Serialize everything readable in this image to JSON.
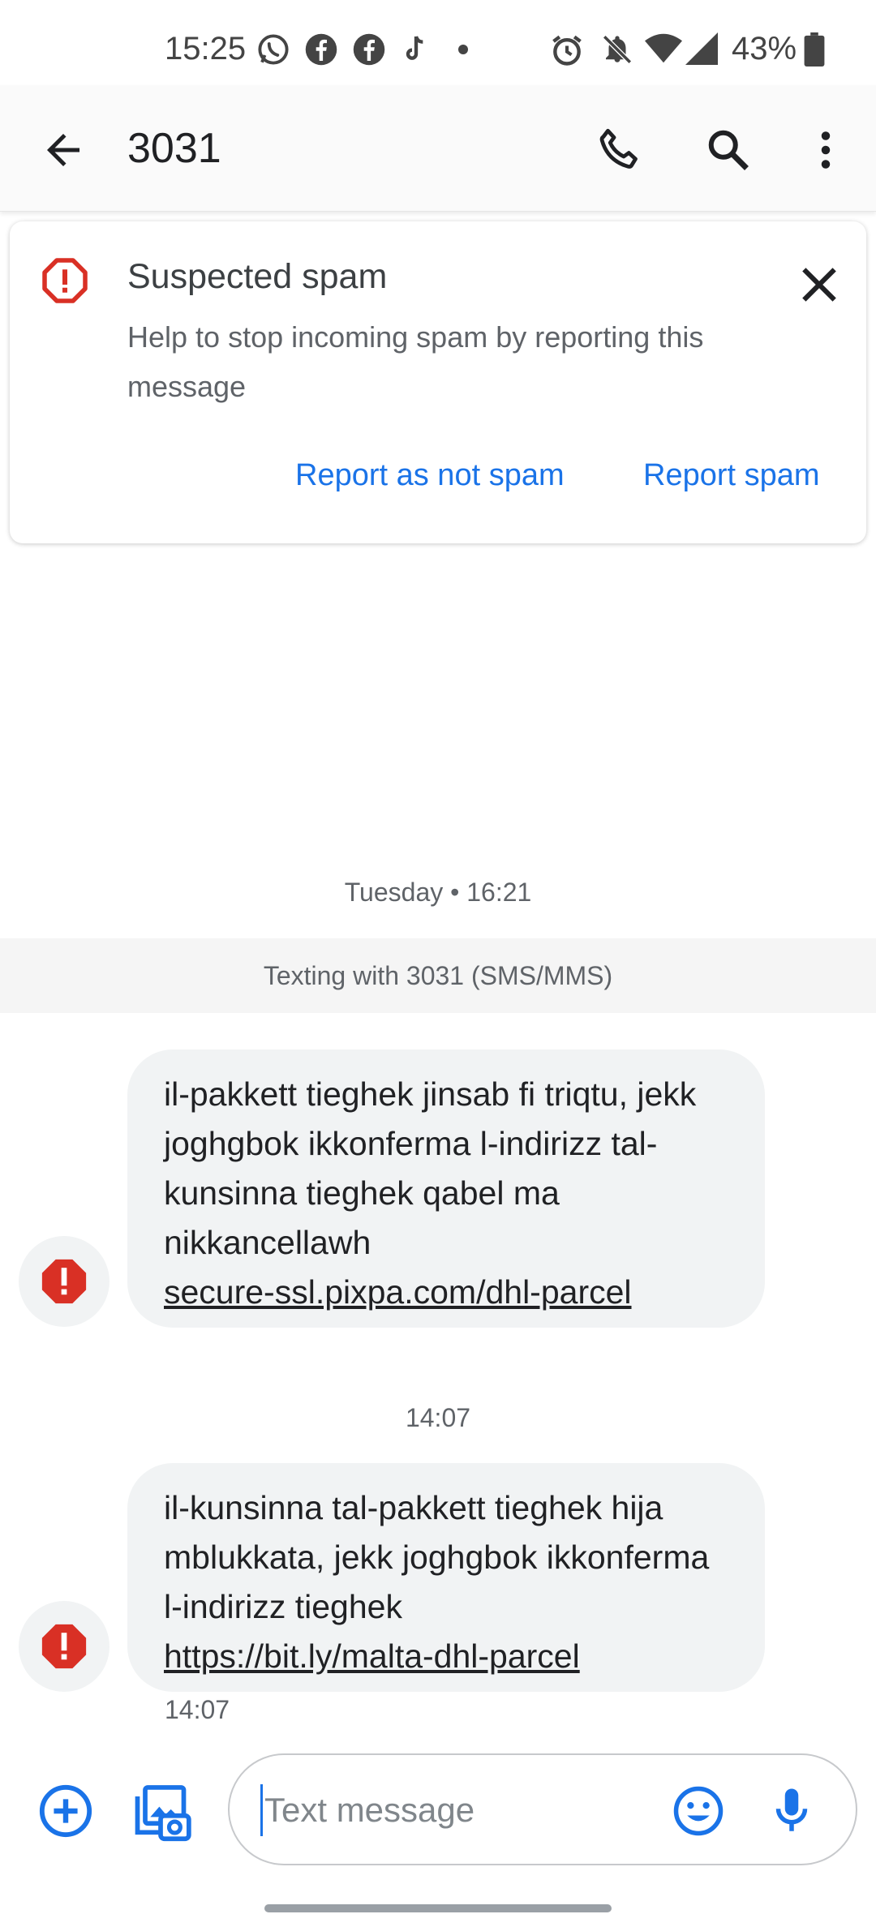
{
  "status_bar": {
    "time": "15:25",
    "notification_icons": [
      "whatsapp-icon",
      "facebook-icon",
      "facebook-icon",
      "tiktok-icon",
      "dot-icon"
    ],
    "system_icons": [
      "alarm-icon",
      "bell-off-icon",
      "wifi-icon",
      "cell-signal-icon",
      "battery-icon"
    ],
    "battery": "43%"
  },
  "app_bar": {
    "title": "3031",
    "icons": [
      "back-arrow-icon",
      "phone-icon",
      "search-icon",
      "more-vert-icon"
    ]
  },
  "spam_banner": {
    "title": "Suspected spam",
    "description": "Help to stop incoming spam by reporting this message",
    "not_spam_label": "Report as not spam",
    "spam_label": "Report spam",
    "accent_color": "#d93025",
    "link_color": "#1a73e8"
  },
  "conversation": {
    "date_header": "Tuesday • 16:21",
    "texting_with": "Texting with 3031 (SMS/MMS)",
    "messages": [
      {
        "text": "il-pakkett tieghek jinsab fi triqtu, jekk joghgbok ikkonferma l-indirizz tal-kunsinna tieghek qabel ma nikkancellawh",
        "link": "secure-ssl.pixpa.com/dhl-parcel",
        "time_above": "14:07"
      },
      {
        "text": "il-kunsinna tal-pakkett tieghek hija mblukkata, jekk joghgbok ikkonferma l-indirizz tieghek",
        "link": "https://bit.ly/malta-dhl-parcel",
        "time_below": "14:07"
      }
    ]
  },
  "compose": {
    "placeholder": "Text message",
    "icons": [
      "add-circle-icon",
      "gallery-icon",
      "emoji-icon",
      "mic-icon"
    ]
  }
}
